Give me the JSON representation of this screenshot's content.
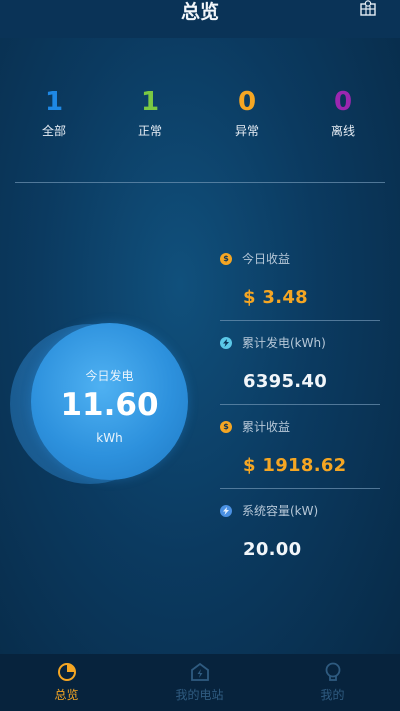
{
  "header": {
    "title": "总览"
  },
  "summary": [
    {
      "value": "1",
      "label": "全部",
      "color": "#1e88e5"
    },
    {
      "value": "1",
      "label": "正常",
      "color": "#7ac943"
    },
    {
      "value": "0",
      "label": "异常",
      "color": "#f5a623"
    },
    {
      "value": "0",
      "label": "离线",
      "color": "#9c27b0"
    }
  ],
  "today_generation": {
    "label": "今日发电",
    "value": "11.60",
    "unit": "kWh"
  },
  "metrics": [
    {
      "icon": "dollar-icon",
      "icon_color": "#f5a623",
      "label": "今日收益",
      "value": "$ 3.48"
    },
    {
      "icon": "lightning-icon",
      "icon_color": "#5bc8e8",
      "label": "累计发电(kWh)",
      "value": "6395.40"
    },
    {
      "icon": "dollar-icon",
      "icon_color": "#f5a623",
      "label": "累计收益",
      "value": "$ 1918.62"
    },
    {
      "icon": "lightning-icon",
      "icon_color": "#4a90e2",
      "label": "系统容量(kW)",
      "value": "20.00"
    }
  ],
  "tabs": [
    {
      "label": "总览",
      "icon": "pie-chart-icon",
      "active": true
    },
    {
      "label": "我的电站",
      "icon": "power-station-icon",
      "active": false
    },
    {
      "label": "我的",
      "icon": "user-bulb-icon",
      "active": false
    }
  ],
  "colors": {
    "accent": "#f5a623",
    "inactive": "#2f5b80",
    "background": "#0b3a60"
  }
}
